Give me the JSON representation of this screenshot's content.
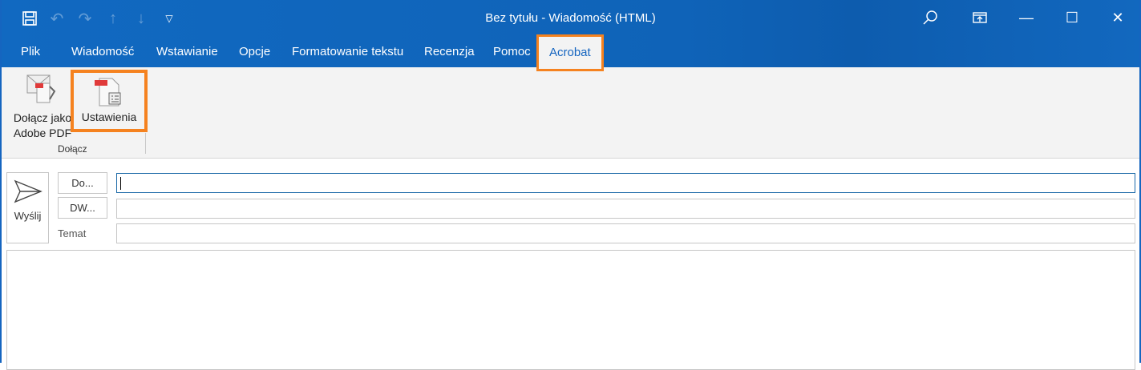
{
  "window": {
    "title": "Bez tytułu  -  Wiadomość (HTML)"
  },
  "quick_access": [
    "save-icon",
    "undo-icon",
    "redo-icon",
    "up-icon",
    "down-icon",
    "customize-icon"
  ],
  "tabs": [
    {
      "label": "Plik"
    },
    {
      "label": "Wiadomość"
    },
    {
      "label": "Wstawianie"
    },
    {
      "label": "Opcje"
    },
    {
      "label": "Formatowanie tekstu"
    },
    {
      "label": "Recenzja"
    },
    {
      "label": "Pomoc"
    },
    {
      "label": "Acrobat"
    }
  ],
  "ribbon": {
    "attach_pdf_line1": "Dołącz jako",
    "attach_pdf_line2": "Adobe PDF",
    "settings": "Ustawienia",
    "group": "Dołącz"
  },
  "compose": {
    "send": "Wyślij",
    "to": "Do...",
    "cc": "DW...",
    "subject_label": "Temat",
    "to_value": "",
    "cc_value": "",
    "subject_value": ""
  },
  "colors": {
    "accent": "#1565c0",
    "highlight": "#f5821f"
  }
}
